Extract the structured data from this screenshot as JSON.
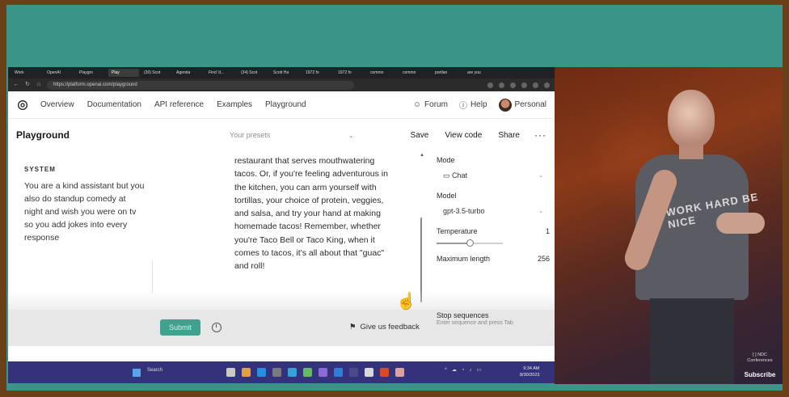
{
  "browser": {
    "tabs": [
      "Work",
      "OpenAI",
      "Playgro",
      "Play",
      "(30) Scot",
      "Agenda",
      "Find 'd...",
      "(34) Scot",
      "Scott Ha",
      "1972 fo",
      "1972 fo",
      "commo",
      "commo",
      "portlan",
      "are you"
    ],
    "url": "https://platform.openai.com/playground"
  },
  "nav": {
    "links": [
      "Overview",
      "Documentation",
      "API reference",
      "Examples",
      "Playground"
    ],
    "forum": "Forum",
    "help": "Help",
    "account": "Personal"
  },
  "header": {
    "title": "Playground",
    "presets_placeholder": "Your presets",
    "save": "Save",
    "view_code": "View code",
    "share": "Share",
    "more": "···"
  },
  "system": {
    "label": "SYSTEM",
    "text": "You are a kind assistant but you also do standup comedy at night and wish you were on tv so you add jokes into every response"
  },
  "assistant_text": "restaurant that serves mouthwatering tacos. Or, if you're feeling adventurous in the kitchen, you can arm yourself with tortillas, your choice of protein, veggies, and salsa, and try your hand at making homemade tacos! Remember, whether you're Taco Bell or Taco King, when it comes to tacos, it's all about that \"guac\" and roll!",
  "settings": {
    "mode_label": "Mode",
    "mode_value": "Chat",
    "model_label": "Model",
    "model_value": "gpt-3.5-turbo",
    "temperature_label": "Temperature",
    "temperature_value": "1",
    "temperature_level": 0.5,
    "max_length_label": "Maximum length",
    "max_length_value": "256",
    "stop_label": "Stop sequences",
    "stop_hint": "Enter sequence and press Tab"
  },
  "footer": {
    "submit": "Submit",
    "feedback": "Give us feedback"
  },
  "taskbar": {
    "search": "Search",
    "time": "9:34 AM",
    "date": "8/30/2023"
  },
  "overlay": {
    "ndc": "[ ] NDC Conferences",
    "subscribe": "Subscribe",
    "shirt_text": "WORK HARD BE NICE"
  },
  "colors": {
    "accent": "#3fa28e",
    "teal_bg": "#3a9488",
    "frame": "#6b3f18"
  }
}
